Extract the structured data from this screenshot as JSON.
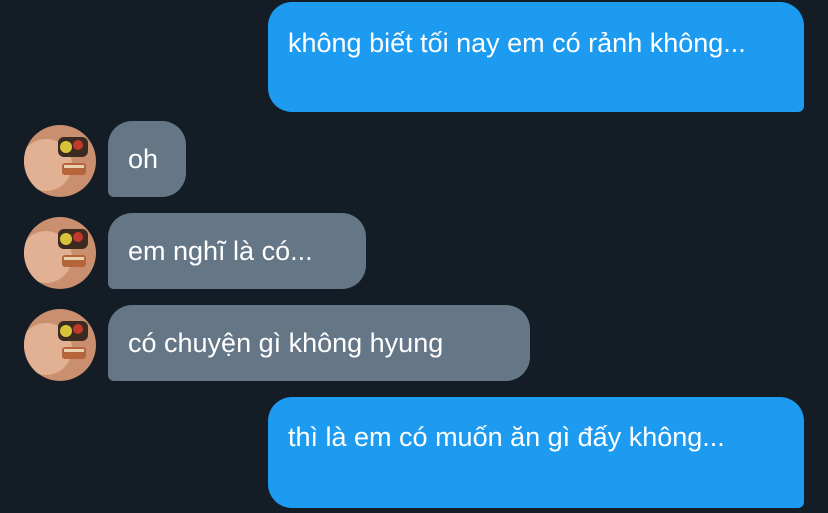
{
  "conversation": {
    "messages": [
      {
        "sender": "self",
        "text": "không biết tối nay em có rảnh không..."
      },
      {
        "sender": "other",
        "text": "oh"
      },
      {
        "sender": "other",
        "text": "em nghĩ là có..."
      },
      {
        "sender": "other",
        "text": "có chuyện gì không hyung"
      },
      {
        "sender": "self",
        "text": "thì là em có muốn ăn gì đấy không..."
      }
    ]
  },
  "colors": {
    "background": "#141d26",
    "sent_bubble": "#1d9bf0",
    "received_bubble": "#657786",
    "text": "#ffffff"
  }
}
